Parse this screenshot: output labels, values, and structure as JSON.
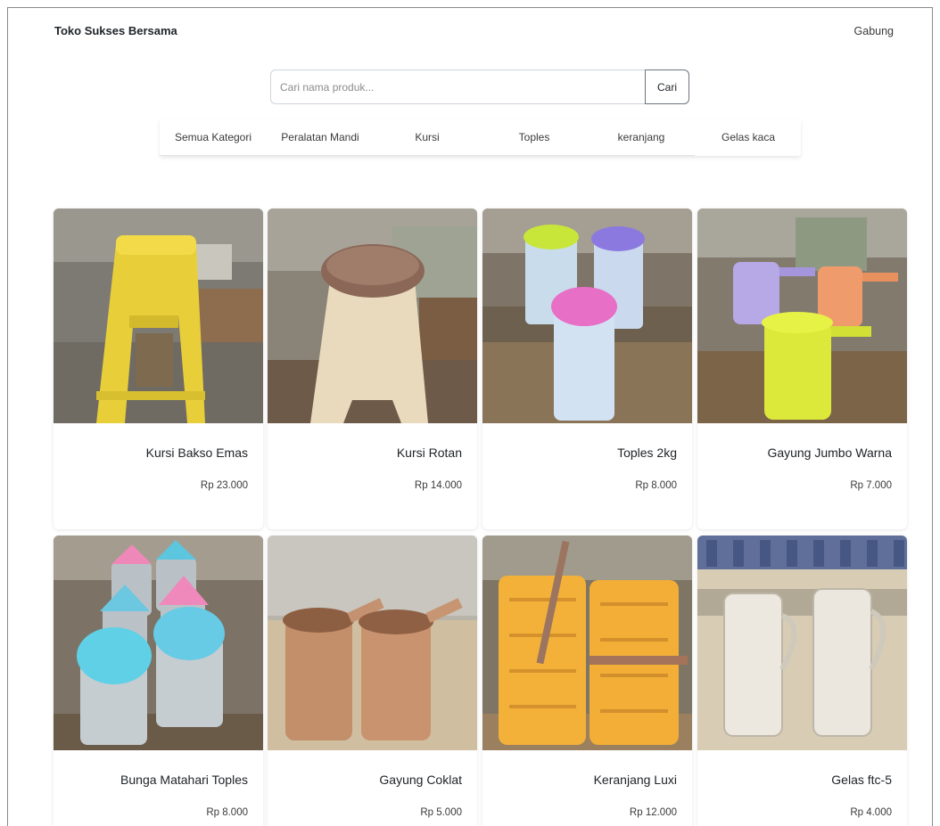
{
  "navbar": {
    "brand": "Toko Sukses Bersama",
    "join_label": "Gabung"
  },
  "search": {
    "placeholder": "Cari nama produk...",
    "value": "",
    "button_label": "Cari"
  },
  "categories": [
    "Semua Kategori",
    "Peralatan Mandi",
    "Kursi",
    "Toples",
    "keranjang",
    "Gelas kaca"
  ],
  "products": [
    {
      "name": "Kursi Bakso Emas",
      "price": "Rp 23.000",
      "image": "yellow-plastic-stool"
    },
    {
      "name": "Kursi Rotan",
      "price": "Rp 14.000",
      "image": "beige-rattan-stool"
    },
    {
      "name": "Toples 2kg",
      "price": "Rp 8.000",
      "image": "plastic-jars"
    },
    {
      "name": "Gayung Jumbo Warna",
      "price": "Rp 7.000",
      "image": "water-dippers"
    },
    {
      "name": "Bunga Matahari Toples",
      "price": "Rp 8.000",
      "image": "glass-jars-blue-lids"
    },
    {
      "name": "Gayung Coklat",
      "price": "Rp 5.000",
      "image": "brown-dippers"
    },
    {
      "name": "Keranjang Luxi",
      "price": "Rp 12.000",
      "image": "orange-baskets"
    },
    {
      "name": "Gelas ftc-5",
      "price": "Rp 4.000",
      "image": "glass-mugs"
    }
  ],
  "colors": {
    "text": "#212529",
    "border": "#ced4da",
    "button_border": "#6c757d"
  }
}
